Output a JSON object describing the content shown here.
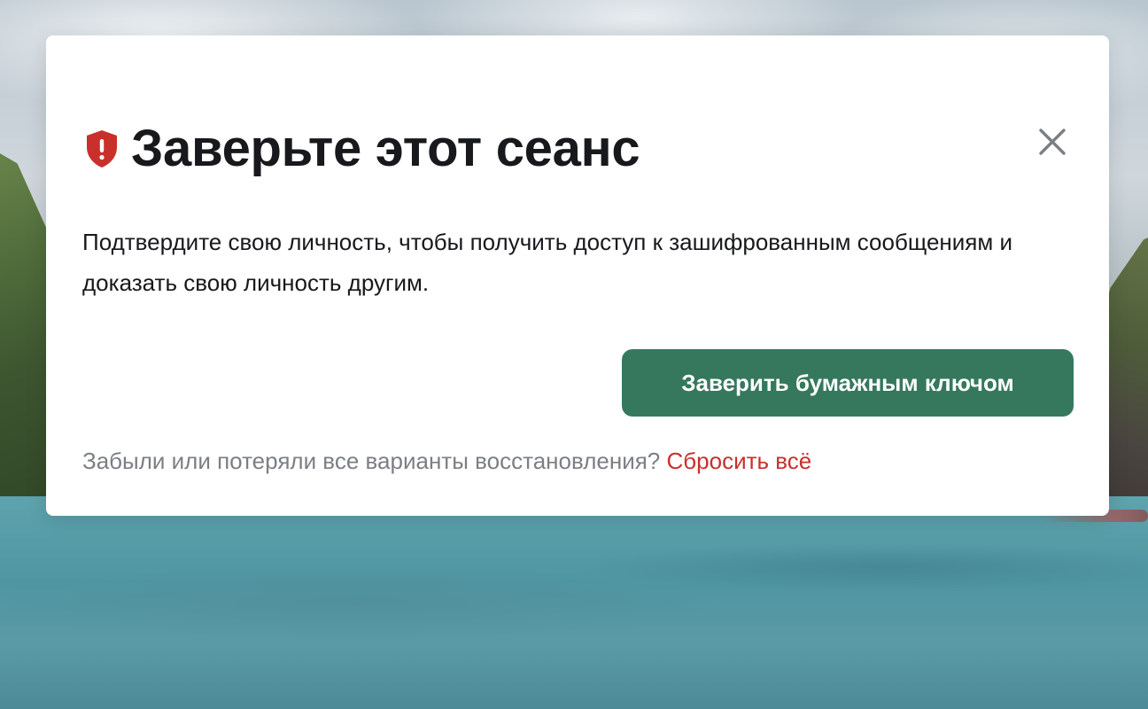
{
  "dialog": {
    "title": "Заверьте этот сеанс",
    "title_icon": "shield-alert-icon",
    "close_icon": "close-icon",
    "description": "Подтвердите свою личность, чтобы получить доступ к зашифрованным сообщениям и доказать свою личность другим.",
    "primary_button_label": "Заверить бумажным ключом",
    "footer_question": "Забыли или потеряли все варианты восстановления?",
    "reset_link_label": "Сбросить всё"
  },
  "colors": {
    "accent": "#35785e",
    "danger": "#c9302c",
    "title_text": "#17191c",
    "muted_text": "#7b7f84",
    "dialog_background": "#ffffff"
  }
}
